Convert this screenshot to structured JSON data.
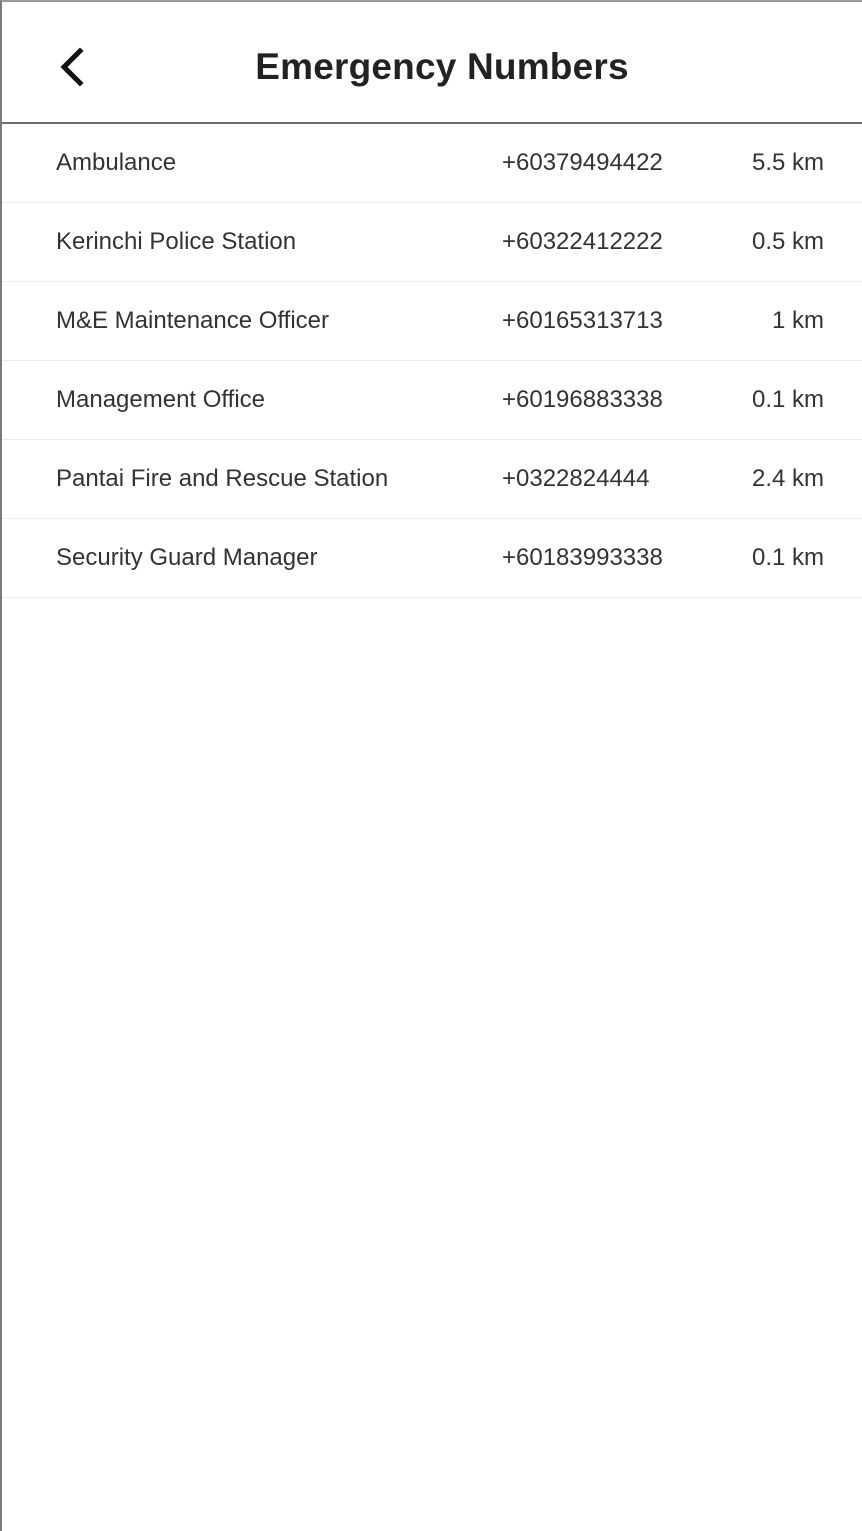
{
  "header": {
    "title": "Emergency Numbers",
    "back_icon": "chevron-left-icon"
  },
  "contacts": [
    {
      "name": "Ambulance",
      "phone": "+60379494422",
      "distance": "5.5 km"
    },
    {
      "name": "Kerinchi Police Station",
      "phone": "+60322412222",
      "distance": "0.5 km"
    },
    {
      "name": "M&E Maintenance Officer",
      "phone": "+60165313713",
      "distance": "1 km"
    },
    {
      "name": "Management Office",
      "phone": "+60196883338",
      "distance": "0.1 km"
    },
    {
      "name": "Pantai Fire and Rescue Station",
      "phone": "+0322824444",
      "distance": "2.4 km"
    },
    {
      "name": "Security Guard Manager",
      "phone": "+60183993338",
      "distance": "0.1 km"
    }
  ]
}
